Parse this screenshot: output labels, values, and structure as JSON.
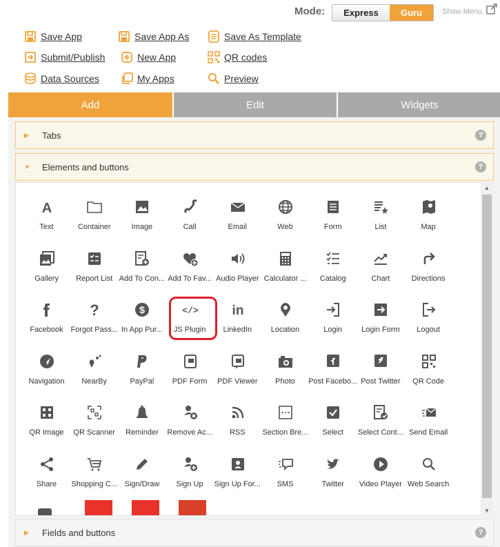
{
  "mode": {
    "label": "Mode:",
    "express": "Express",
    "guru": "Guru",
    "show_menu": "Show Menu"
  },
  "actions": {
    "save_app": "Save App",
    "save_app_as": "Save App As",
    "save_as_template": "Save As Template",
    "submit_publish": "Submit/Publish",
    "new_app": "New App",
    "qr_codes": "QR codes",
    "data_sources": "Data Sources",
    "my_apps": "My Apps",
    "preview": "Preview"
  },
  "tabs": {
    "add": "Add",
    "edit": "Edit",
    "widgets": "Widgets"
  },
  "sections": {
    "tabs": "Tabs",
    "elements": "Elements and buttons",
    "fields": "Fields and buttons",
    "help": "?"
  },
  "elements": [
    "Text",
    "Container",
    "Image",
    "Call",
    "Email",
    "Web",
    "Form",
    "List",
    "Map",
    "Gallery",
    "Report List",
    "Add To Con...",
    "Add To Fav...",
    "Audio Player",
    "Calculator ...",
    "Catalog",
    "Chart",
    "Directions",
    "Facebook",
    "Forgot Pass...",
    "In App Pur...",
    "JS Plugin",
    "LinkedIn",
    "Location",
    "Login",
    "Login Form",
    "Logout",
    "Navigation",
    "NearBy",
    "PayPal",
    "PDF Form",
    "PDF Viewer",
    "Photo",
    "Post Facebo...",
    "Post Twitter",
    "QR Code",
    "QR Image",
    "QR Scanner",
    "Reminder",
    "Remove Ac...",
    "RSS",
    "Section Bre...",
    "Select",
    "Select Cont...",
    "Send Email",
    "Share",
    "Shopping C...",
    "Sign/Draw",
    "Sign Up",
    "Sign Up For...",
    "SMS",
    "Twitter",
    "Video Player",
    "Web Search"
  ],
  "colors": {
    "accent": "#f0a33a",
    "tab_inactive": "#a9a9a9",
    "highlight": "#d9202a"
  }
}
